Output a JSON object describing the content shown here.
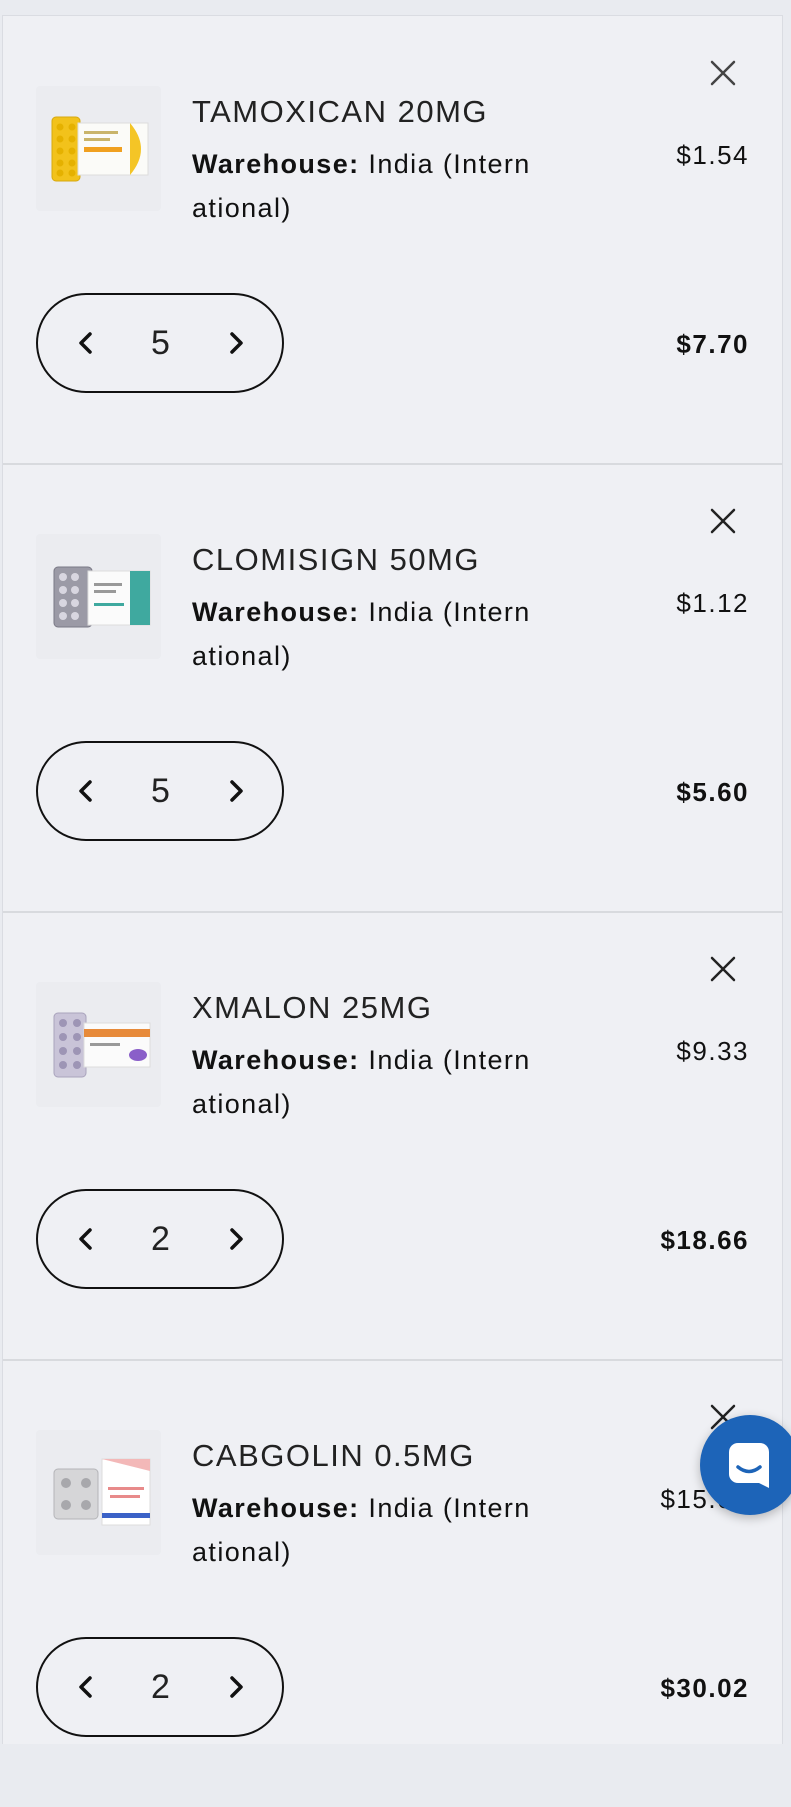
{
  "cart": {
    "items": [
      {
        "name": "TAMOXICAN 20MG",
        "warehouse_label": "Warehouse:",
        "warehouse_value": " India (Intern ational)",
        "unit_price": "$1.54",
        "quantity": "5",
        "total": "$7.70"
      },
      {
        "name": "CLOMISIGN 50MG",
        "warehouse_label": "Warehouse:",
        "warehouse_value": " India (Intern ational)",
        "unit_price": "$1.12",
        "quantity": "5",
        "total": "$5.60"
      },
      {
        "name": "XMALON 25MG",
        "warehouse_label": "Warehouse:",
        "warehouse_value": " India (Intern ational)",
        "unit_price": "$9.33",
        "quantity": "2",
        "total": "$18.66"
      },
      {
        "name": "CABGOLIN 0.5MG",
        "warehouse_label": "Warehouse:",
        "warehouse_value": " India (Intern ational)",
        "unit_price": "$15.01",
        "quantity": "2",
        "total": "$30.02"
      }
    ]
  },
  "icons": {
    "remove": "close-icon",
    "decrease": "chevron-left-icon",
    "increase": "chevron-right-icon",
    "chat": "chat-bubble-icon"
  },
  "colors": {
    "background": "#eff0f4",
    "chat_button": "#1d64b8",
    "text": "#111111"
  }
}
